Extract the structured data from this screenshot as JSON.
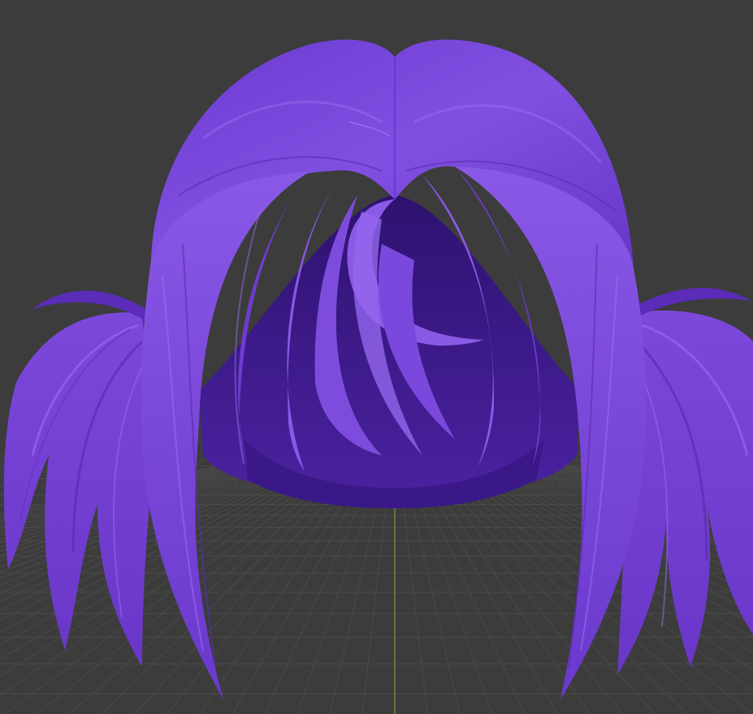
{
  "viewport": {
    "view": "3d-perspective",
    "background_color": "#3c3c3c",
    "grid_color": "#4a4a4a",
    "axis_color": "#7fb33a",
    "grid_visible": true
  },
  "model": {
    "object": "hair-mesh",
    "base_color": "#7a45d8",
    "shadow_color": "#4a2296",
    "highlight_color": "#9a6cf0",
    "inner_color": "#3e1a86"
  }
}
